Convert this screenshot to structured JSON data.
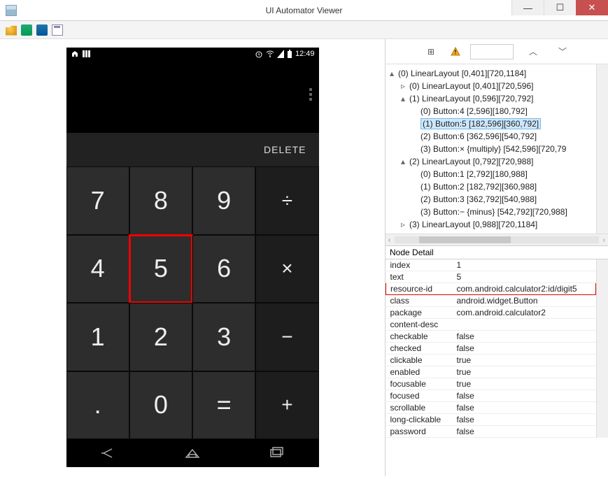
{
  "window": {
    "title": "UI Automator Viewer"
  },
  "phone": {
    "time": "12:49",
    "delete": "DELETE",
    "keys": [
      {
        "t": "7",
        "sel": false,
        "op": false
      },
      {
        "t": "8",
        "sel": false,
        "op": false
      },
      {
        "t": "9",
        "sel": false,
        "op": false
      },
      {
        "t": "÷",
        "sel": false,
        "op": true
      },
      {
        "t": "4",
        "sel": false,
        "op": false
      },
      {
        "t": "5",
        "sel": true,
        "op": false
      },
      {
        "t": "6",
        "sel": false,
        "op": false
      },
      {
        "t": "×",
        "sel": false,
        "op": true
      },
      {
        "t": "1",
        "sel": false,
        "op": false
      },
      {
        "t": "2",
        "sel": false,
        "op": false
      },
      {
        "t": "3",
        "sel": false,
        "op": false
      },
      {
        "t": "−",
        "sel": false,
        "op": true
      },
      {
        "t": ".",
        "sel": false,
        "op": false
      },
      {
        "t": "0",
        "sel": false,
        "op": false
      },
      {
        "t": "=",
        "sel": false,
        "op": false
      },
      {
        "t": "+",
        "sel": false,
        "op": true
      }
    ]
  },
  "tree": [
    {
      "depth": 0,
      "toggle": "▴",
      "text": "(0) LinearLayout [0,401][720,1184]",
      "sel": false
    },
    {
      "depth": 1,
      "toggle": "▹",
      "text": "(0) LinearLayout [0,401][720,596]",
      "sel": false
    },
    {
      "depth": 1,
      "toggle": "▴",
      "text": "(1) LinearLayout [0,596][720,792]",
      "sel": false
    },
    {
      "depth": 2,
      "toggle": "",
      "text": "(0) Button:4 [2,596][180,792]",
      "sel": false
    },
    {
      "depth": 2,
      "toggle": "",
      "text": "(1) Button:5 [182,596][360,792]",
      "sel": true
    },
    {
      "depth": 2,
      "toggle": "",
      "text": "(2) Button:6 [362,596][540,792]",
      "sel": false
    },
    {
      "depth": 2,
      "toggle": "",
      "text": "(3) Button:× {multiply} [542,596][720,79",
      "sel": false
    },
    {
      "depth": 1,
      "toggle": "▴",
      "text": "(2) LinearLayout [0,792][720,988]",
      "sel": false
    },
    {
      "depth": 2,
      "toggle": "",
      "text": "(0) Button:1 [2,792][180,988]",
      "sel": false
    },
    {
      "depth": 2,
      "toggle": "",
      "text": "(1) Button:2 [182,792][360,988]",
      "sel": false
    },
    {
      "depth": 2,
      "toggle": "",
      "text": "(2) Button:3 [362,792][540,988]",
      "sel": false
    },
    {
      "depth": 2,
      "toggle": "",
      "text": "(3) Button:− {minus} [542,792][720,988]",
      "sel": false
    },
    {
      "depth": 1,
      "toggle": "▹",
      "text": "(3) LinearLayout [0,988][720,1184]",
      "sel": false
    }
  ],
  "detail": {
    "header": "Node Detail",
    "rows": [
      {
        "k": "index",
        "v": "1",
        "hl": false
      },
      {
        "k": "text",
        "v": "5",
        "hl": false
      },
      {
        "k": "resource-id",
        "v": "com.android.calculator2:id/digit5",
        "hl": true
      },
      {
        "k": "class",
        "v": "android.widget.Button",
        "hl": false
      },
      {
        "k": "package",
        "v": "com.android.calculator2",
        "hl": false
      },
      {
        "k": "content-desc",
        "v": "",
        "hl": false
      },
      {
        "k": "checkable",
        "v": "false",
        "hl": false
      },
      {
        "k": "checked",
        "v": "false",
        "hl": false
      },
      {
        "k": "clickable",
        "v": "true",
        "hl": false
      },
      {
        "k": "enabled",
        "v": "true",
        "hl": false
      },
      {
        "k": "focusable",
        "v": "true",
        "hl": false
      },
      {
        "k": "focused",
        "v": "false",
        "hl": false
      },
      {
        "k": "scrollable",
        "v": "false",
        "hl": false
      },
      {
        "k": "long-clickable",
        "v": "false",
        "hl": false
      },
      {
        "k": "password",
        "v": "false",
        "hl": false
      }
    ]
  }
}
